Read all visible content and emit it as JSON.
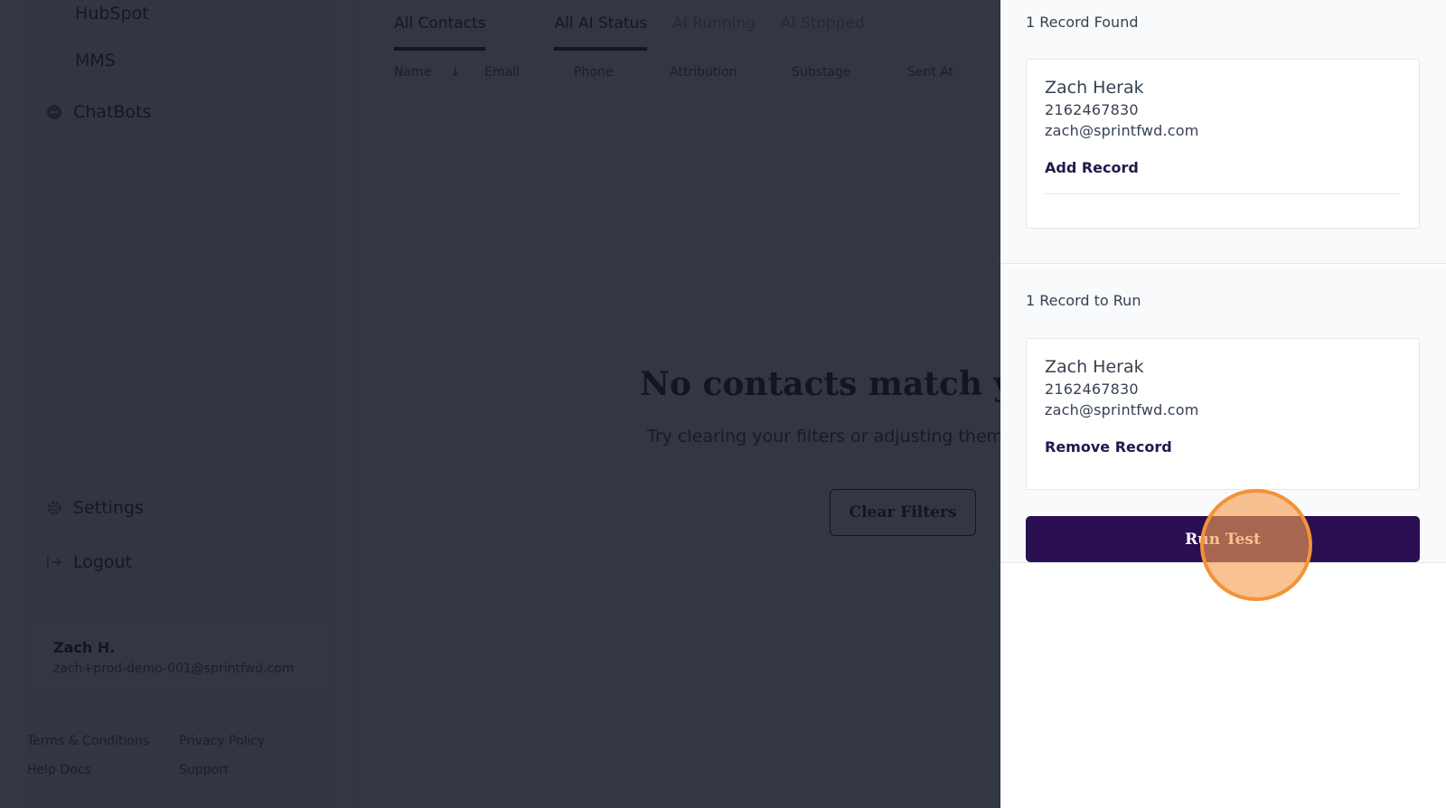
{
  "sidebar": {
    "items": [
      {
        "label": "HubSpot"
      },
      {
        "label": "MMS"
      },
      {
        "label": "ChatBots",
        "icon": "chatbot-icon"
      },
      {
        "label": "Settings",
        "icon": "gear-icon"
      },
      {
        "label": "Logout",
        "icon": "logout-icon"
      }
    ],
    "profile": {
      "name": "Zach H.",
      "email": "zach+prod-demo-001@sprintfwd.com"
    },
    "footer": {
      "terms": "Terms & Conditions",
      "privacy": "Privacy Policy",
      "help": "Help Docs",
      "support": "Support"
    }
  },
  "main": {
    "tabs": [
      {
        "label": "All Contacts",
        "active": true
      },
      {
        "label": "All AI Status",
        "active": true
      },
      {
        "label": "AI Running",
        "active": false
      },
      {
        "label": "AI Stopped",
        "active": false
      }
    ],
    "columns": [
      "Name",
      "Email",
      "Phone",
      "Attribution",
      "Substage",
      "Sent At"
    ],
    "sort_indicator": "↓",
    "empty_title": "No contacts match yo",
    "empty_subtitle": "Try clearing your filters or adjusting them to",
    "clear_button": "Clear Filters"
  },
  "panel": {
    "found": {
      "title": "1 Record Found",
      "record": {
        "name": "Zach Herak",
        "phone": "2162467830",
        "email": "zach@sprintfwd.com"
      },
      "action": "Add Record"
    },
    "to_run": {
      "title": "1 Record to Run",
      "record": {
        "name": "Zach Herak",
        "phone": "2162467830",
        "email": "zach@sprintfwd.com"
      },
      "action": "Remove Record"
    },
    "run_button": "Run Test"
  },
  "colors": {
    "accent": "#2a0f52",
    "click_highlight": "#f39237",
    "active_tab": "#1e1b4b"
  }
}
